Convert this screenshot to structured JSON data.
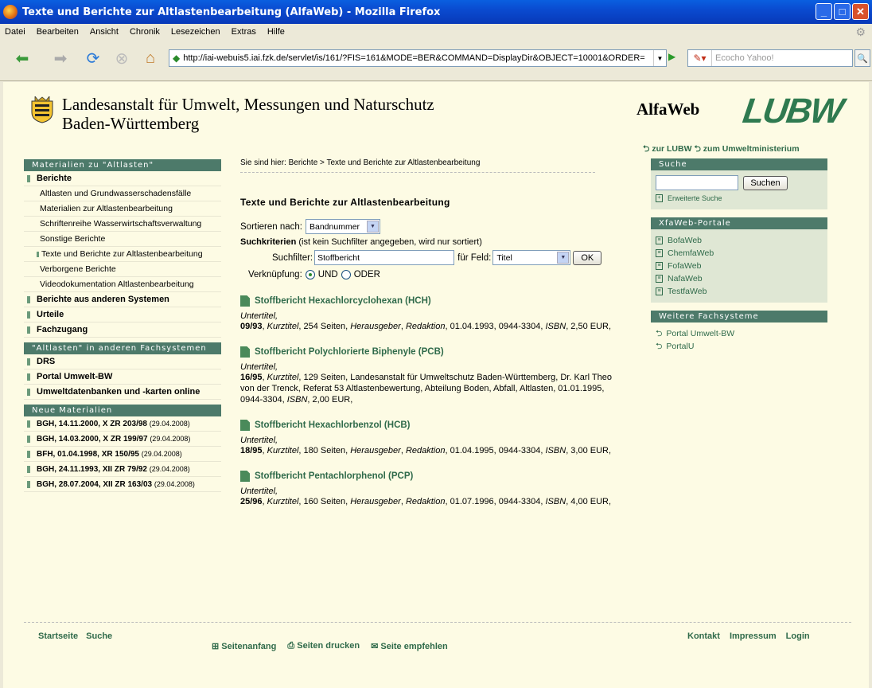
{
  "window": {
    "title": "Texte und Berichte zur Altlastenbearbeitung (AlfaWeb) - Mozilla Firefox"
  },
  "menu": [
    "Datei",
    "Bearbeiten",
    "Ansicht",
    "Chronik",
    "Lesezeichen",
    "Extras",
    "Hilfe"
  ],
  "browser": {
    "url": "http://iai-webuis5.iai.fzk.de/servlet/is/161/?FIS=161&MODE=BER&COMMAND=DisplayDir&OBJECT=10001&ORDER=",
    "search_placeholder": "Ecocho Yahoo!"
  },
  "header": {
    "org_line1": "Landesanstalt für Umwelt, Messungen und Naturschutz",
    "org_line2": "Baden-Württemberg",
    "app_name": "AlfaWeb",
    "logo_text": "LUBW"
  },
  "leftnav": {
    "section1_title": "Materialien zu \"Altlasten\"",
    "berichte": "Berichte",
    "sub": [
      "Altlasten und Grundwasserschadensfälle",
      "Materialien zur Altlastenbearbeitung",
      "Schriftenreihe Wasserwirtschaftsverwaltung",
      "Sonstige Berichte",
      "Texte und Berichte zur Altlastenbearbeitung",
      "Verborgene Berichte",
      "Videodokumentation Altlastenbearbeitung"
    ],
    "items1": [
      "Berichte aus anderen Systemen",
      "Urteile",
      "Fachzugang"
    ],
    "section2_title": "\"Altlasten\" in anderen Fachsystemen",
    "items2": [
      "DRS",
      "Portal Umwelt-BW",
      "Umweltdatenbanken und -karten online"
    ],
    "section3_title": "Neue Materialien",
    "new_items": [
      {
        "label": "BGH, 14.11.2000, X ZR 203/98",
        "date": "(29.04.2008)"
      },
      {
        "label": "BGH, 14.03.2000, X ZR 199/97",
        "date": "(29.04.2008)"
      },
      {
        "label": "BFH, 01.04.1998, XR 150/95",
        "date": "(29.04.2008)"
      },
      {
        "label": "BGH, 24.11.1993, XII ZR 79/92",
        "date": "(29.04.2008)"
      },
      {
        "label": "BGH, 28.07.2004, XII ZR 163/03",
        "date": "(29.04.2008)"
      }
    ]
  },
  "main": {
    "breadcrumb": "Sie sind hier: Berichte > Texte und Berichte zur Altlastenbearbeitung",
    "title": "Texte und Berichte zur Altlastenbearbeitung",
    "sort_label": "Sortieren nach:",
    "sort_value": "Bandnummer",
    "criteria_bold": "Suchkriterien",
    "criteria_rest": " (ist kein Suchfilter angegeben, wird nur sortiert)",
    "filter_label": "Suchfilter:",
    "filter_value": "Stoffbericht",
    "field_label": "für Feld:",
    "field_value": "Titel",
    "ok_label": "OK",
    "link_label": "Verknüpfung:",
    "und_label": "UND",
    "oder_label": "ODER",
    "results": [
      {
        "title": "Stoffbericht Hexachlorcyclohexan (HCH)",
        "subtitle": "Untertitel,",
        "num": "09/93",
        "short": "Kurztitel",
        "text1": ", 254 Seiten, ",
        "publisher": "Herausgeber",
        "text2": ", ",
        "editor": "Redaktion",
        "text3": ", 01.04.1993, 0944-3304, ",
        "isbn": "ISBN",
        "text4": ", 2,50 EUR,"
      },
      {
        "title": "Stoffbericht Polychlorierte Biphenyle (PCB)",
        "subtitle": "Untertitel,",
        "num": "16/95",
        "short": "Kurztitel",
        "text1": ", 129 Seiten, Landesanstalt für Umweltschutz Baden-Württemberg, Dr. Karl Theo von der Trenck, Referat 53 Altlastenbewertung, Abteilung Boden, Abfall, Altlasten, 01.01.1995, 0944-3304, ",
        "publisher": "",
        "text2": "",
        "editor": "",
        "text3": "",
        "isbn": "ISBN",
        "text4": ", 2,00 EUR,"
      },
      {
        "title": "Stoffbericht Hexachlorbenzol (HCB)",
        "subtitle": "Untertitel,",
        "num": "18/95",
        "short": "Kurztitel",
        "text1": ", 180 Seiten, ",
        "publisher": "Herausgeber",
        "text2": ", ",
        "editor": "Redaktion",
        "text3": ", 01.04.1995, 0944-3304, ",
        "isbn": "ISBN",
        "text4": ", 3,00 EUR,"
      },
      {
        "title": "Stoffbericht Pentachlorphenol (PCP)",
        "subtitle": "Untertitel,",
        "num": "25/96",
        "short": "Kurztitel",
        "text1": ", 160 Seiten, ",
        "publisher": "Herausgeber",
        "text2": ", ",
        "editor": "Redaktion",
        "text3": ", 01.07.1996, 0944-3304, ",
        "isbn": "ISBN",
        "text4": ", 4,00 EUR,"
      }
    ]
  },
  "right": {
    "link_lubw": "zur LUBW",
    "link_um": "zum Umweltministerium",
    "search_title": "Suche",
    "search_button": "Suchen",
    "advanced": "Erweiterte Suche",
    "portals_title": "XfaWeb-Portale",
    "portals": [
      "BofaWeb",
      "ChemfaWeb",
      "FofaWeb",
      "NafaWeb",
      "TestfaWeb"
    ],
    "more_title": "Weitere Fachsysteme",
    "more": [
      "Portal Umwelt-BW",
      "PortalU"
    ]
  },
  "footer": {
    "start": "Startseite",
    "search": "Suche",
    "top": "Seitenanfang",
    "print": "Seiten drucken",
    "recommend": "Seite empfehlen",
    "contact": "Kontakt",
    "imprint": "Impressum",
    "login": "Login"
  }
}
